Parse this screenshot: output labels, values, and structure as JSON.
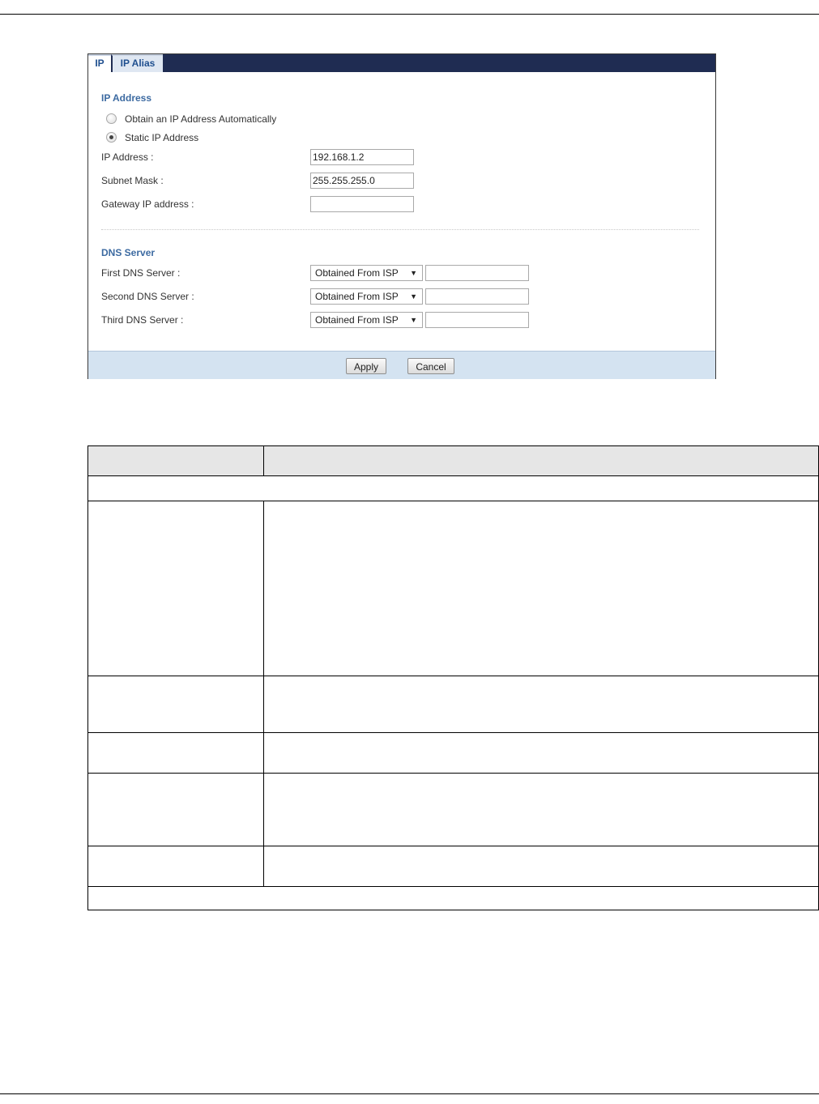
{
  "tabs": [
    {
      "label": "IP",
      "active": true
    },
    {
      "label": "IP Alias",
      "active": false
    }
  ],
  "ip_address": {
    "title": "IP Address",
    "mode_options": [
      {
        "label": "Obtain an IP Address Automatically",
        "selected": false
      },
      {
        "label": "Static IP Address",
        "selected": true
      }
    ],
    "fields": [
      {
        "label": "IP Address :",
        "value": "192.168.1.2"
      },
      {
        "label": "Subnet Mask :",
        "value": "255.255.255.0"
      },
      {
        "label": "Gateway IP address :",
        "value": ""
      }
    ]
  },
  "dns": {
    "title": "DNS Server",
    "servers": [
      {
        "label": "First DNS Server :",
        "mode": "Obtained From ISP",
        "value": ""
      },
      {
        "label": "Second DNS Server :",
        "mode": "Obtained From ISP",
        "value": ""
      },
      {
        "label": "Third DNS Server :",
        "mode": "Obtained From ISP",
        "value": ""
      }
    ]
  },
  "buttons": {
    "apply": "Apply",
    "cancel": "Cancel"
  },
  "colors": {
    "tab_bar": "#1f2c52",
    "section_title": "#3c6aa1",
    "footer_bar": "#d4e3f1",
    "table_header": "#e6e6e6"
  },
  "icons": {
    "select_arrow": "dropdown-arrow-icon"
  }
}
